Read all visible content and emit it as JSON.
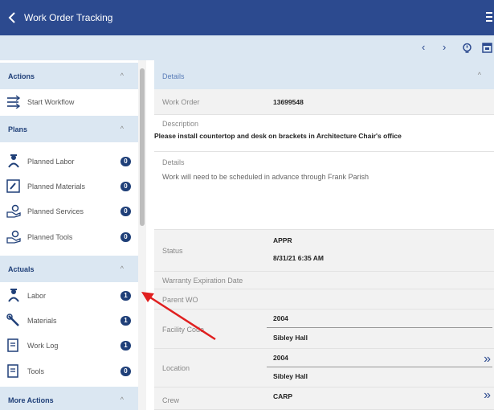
{
  "header": {
    "title": "Work Order Tracking",
    "color": "#2c4a8f"
  },
  "toolbar": {
    "prev_icon": "chevron-left-icon",
    "next_icon": "chevron-right-icon",
    "bulb_icon": "lightbulb-icon",
    "calendar_icon": "calendar-icon"
  },
  "sidebar": {
    "actions": {
      "label": "Actions",
      "items": [
        {
          "label": "Start Workflow",
          "icon": "workflow-icon"
        }
      ]
    },
    "plans": {
      "label": "Plans",
      "items": [
        {
          "label": "Planned Labor",
          "count": "0",
          "icon": "worker-icon"
        },
        {
          "label": "Planned Materials",
          "count": "0",
          "icon": "materials-icon"
        },
        {
          "label": "Planned Services",
          "count": "0",
          "icon": "services-icon"
        },
        {
          "label": "Planned Tools",
          "count": "0",
          "icon": "tools-icon"
        }
      ]
    },
    "actuals": {
      "label": "Actuals",
      "items": [
        {
          "label": "Labor",
          "count": "1",
          "icon": "worker-icon"
        },
        {
          "label": "Materials",
          "count": "1",
          "icon": "wrench-icon"
        },
        {
          "label": "Work Log",
          "count": "1",
          "icon": "log-icon"
        },
        {
          "label": "Tools",
          "count": "0",
          "icon": "log-icon"
        }
      ]
    },
    "more_actions": {
      "label": "More Actions"
    }
  },
  "details": {
    "section_label": "Details",
    "work_order_label": "Work Order",
    "work_order_value": "13699548",
    "description_label": "Description",
    "description_value": "Please install countertop and desk on brackets in Architecture Chair's office",
    "details_label": "Details",
    "details_value": "Work will need to be scheduled in advance through Frank Parish",
    "status_label": "Status",
    "status_value": "APPR",
    "status_date": "8/31/21 6:35 AM",
    "warranty_label": "Warranty Expiration Date",
    "parent_label": "Parent WO",
    "facility_label": "Facility Code",
    "facility_code": "2004",
    "facility_name": "Sibley Hall",
    "location_label": "Location",
    "location_code": "2004",
    "location_name": "Sibley Hall",
    "crew_label": "Crew",
    "crew_value": "CARP"
  },
  "annotation": {
    "arrow_color": "#e02020"
  }
}
